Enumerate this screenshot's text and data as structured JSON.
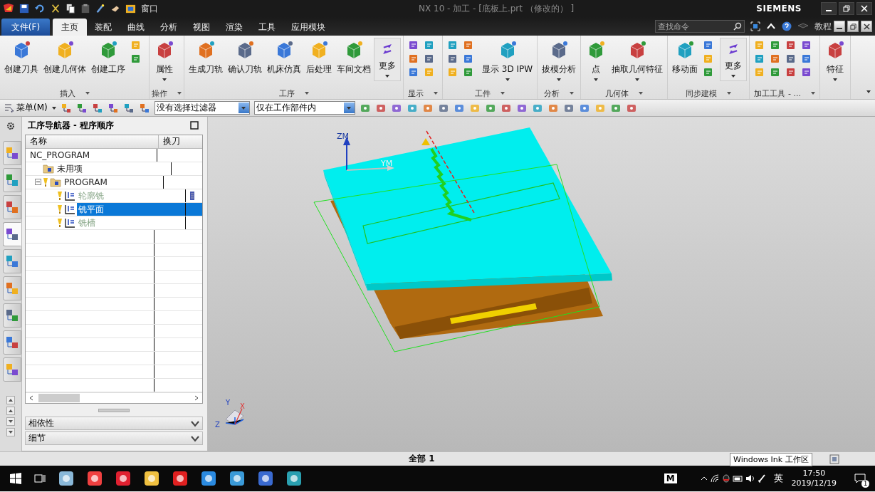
{
  "title_bar": {
    "window_menu": "窗口",
    "title": "NX 10 - 加工 - [底板上.prt （修改的） ]",
    "brand": "SIEMENS"
  },
  "tabs": [
    {
      "label": "文件(F)",
      "kind": "file",
      "selected": false
    },
    {
      "label": "主页",
      "kind": "tab",
      "selected": true
    },
    {
      "label": "装配",
      "kind": "tab",
      "selected": false
    },
    {
      "label": "曲线",
      "kind": "tab",
      "selected": false
    },
    {
      "label": "分析",
      "kind": "tab",
      "selected": false
    },
    {
      "label": "视图",
      "kind": "tab",
      "selected": false
    },
    {
      "label": "渲染",
      "kind": "tab",
      "selected": false
    },
    {
      "label": "工具",
      "kind": "tab",
      "selected": false
    },
    {
      "label": "应用模块",
      "kind": "tab",
      "selected": false
    }
  ],
  "command_search": {
    "placeholder": "查找命令"
  },
  "help_label": "教程",
  "ribbon": [
    {
      "label": "插入",
      "items": [
        {
          "kind": "large",
          "label": "创建刀具",
          "dropdown": false
        },
        {
          "kind": "large",
          "label": "创建几何体",
          "dropdown": false
        },
        {
          "kind": "large",
          "label": "创建工序",
          "dropdown": false
        },
        {
          "kind": "pair"
        }
      ]
    },
    {
      "label": "操作",
      "items": [
        {
          "kind": "large",
          "label": "属性",
          "dropdown": true
        }
      ]
    },
    {
      "label": "工序",
      "items": [
        {
          "kind": "large",
          "label": "生成刀轨",
          "dropdown": false
        },
        {
          "kind": "large",
          "label": "确认刀轨",
          "dropdown": false
        },
        {
          "kind": "large",
          "label": "机床仿真",
          "dropdown": false
        },
        {
          "kind": "large",
          "label": "后处理",
          "dropdown": false
        },
        {
          "kind": "large",
          "label": "车间文档",
          "dropdown": false
        },
        {
          "kind": "more",
          "label": "更多",
          "dropdown": true
        }
      ]
    },
    {
      "label": "显示",
      "items": [
        {
          "kind": "grid"
        }
      ]
    },
    {
      "label": "工件",
      "items": [
        {
          "kind": "grid"
        },
        {
          "kind": "large",
          "label": "显示 3D IPW",
          "dropdown": true
        }
      ]
    },
    {
      "label": "分析",
      "items": [
        {
          "kind": "large",
          "label": "拔模分析",
          "dropdown": true
        }
      ]
    },
    {
      "label": "几何体",
      "items": [
        {
          "kind": "large",
          "label": "点",
          "dropdown": true
        },
        {
          "kind": "large",
          "label": "抽取几何特征",
          "dropdown": true
        }
      ]
    },
    {
      "label": "同步建模",
      "items": [
        {
          "kind": "large",
          "label": "移动面",
          "dropdown": false
        },
        {
          "kind": "column"
        },
        {
          "kind": "more",
          "label": "更多",
          "dropdown": true
        }
      ]
    },
    {
      "label": "加工工具 - ...",
      "items": [
        {
          "kind": "wide"
        }
      ]
    },
    {
      "items": [
        {
          "kind": "large",
          "label": "特征",
          "dropdown": true
        }
      ]
    }
  ],
  "toolbar": {
    "menu_label": "菜单(M)",
    "selection_filter": "没有选择过滤器",
    "scope_filter": "仅在工作部件内"
  },
  "resource_tabs": [
    {
      "selected": false
    },
    {
      "selected": false
    },
    {
      "selected": false
    },
    {
      "selected": true
    },
    {
      "selected": false
    },
    {
      "selected": false
    },
    {
      "selected": false
    },
    {
      "selected": false
    },
    {
      "selected": false
    }
  ],
  "navigator": {
    "title": "工序导航器 - 程序顺序",
    "columns": [
      "名称",
      "换刀"
    ],
    "tree": [
      {
        "label": "NC_PROGRAM",
        "selected": false,
        "children": [
          {
            "label": "未用项",
            "kind": "group",
            "selected": false
          },
          {
            "label": "PROGRAM",
            "kind": "group",
            "selected": false,
            "expanded": true,
            "children": [
              {
                "label": "轮廓铣",
                "kind": "operation",
                "selected": false,
                "tool_change": true
              },
              {
                "label": "铣平面",
                "kind": "operation",
                "selected": true,
                "tool_change": false
              },
              {
                "label": "铣槽",
                "kind": "operation",
                "selected": false,
                "tool_change": false
              }
            ]
          }
        ]
      }
    ],
    "sections": [
      {
        "label": "相依性",
        "expanded": false
      },
      {
        "label": "细节",
        "expanded": false
      }
    ]
  },
  "viewport": {
    "axis_labels": [
      "ZM",
      "YM"
    ],
    "triad_labels": [
      "Y",
      "X",
      "Z"
    ]
  },
  "status_bar": {
    "selection": "全部 1",
    "tooltip": "Windows Ink 工作区"
  },
  "taskbar": {
    "key_badge": "M",
    "ime": "英",
    "time": "17:50",
    "date": "2019/12/19",
    "notifications": "1"
  }
}
